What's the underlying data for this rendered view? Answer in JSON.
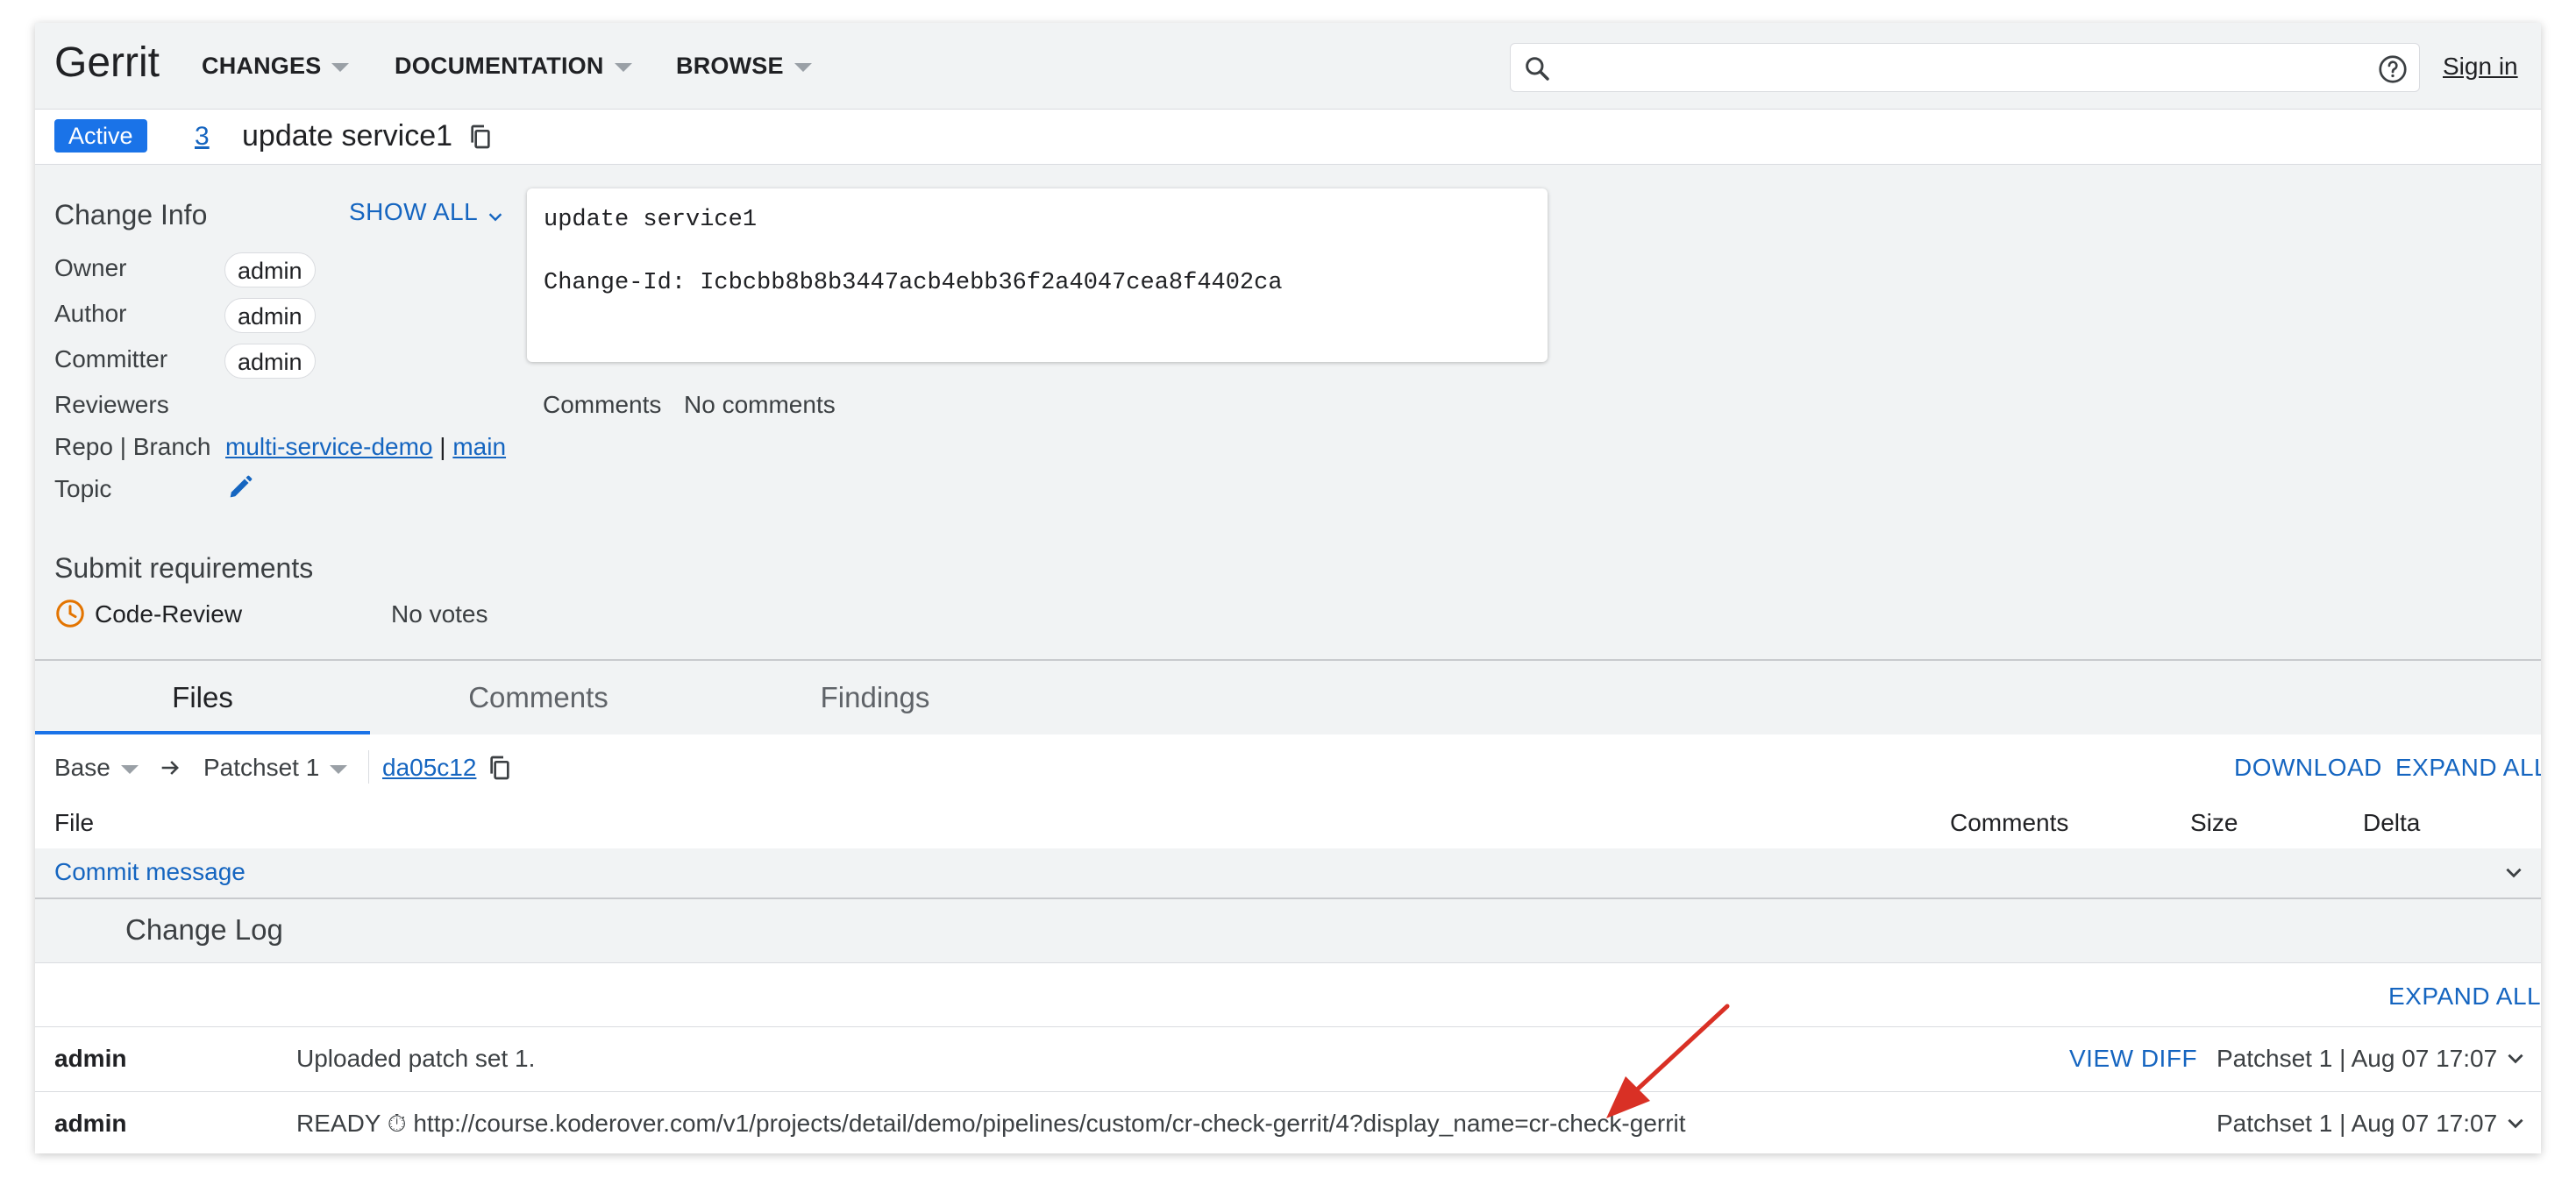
{
  "header": {
    "logo": "Gerrit",
    "nav": [
      "CHANGES",
      "DOCUMENTATION",
      "BROWSE"
    ],
    "search_value": "",
    "sign_in": "Sign in"
  },
  "change": {
    "status": "Active",
    "number": "3",
    "title": "update service1"
  },
  "info": {
    "heading": "Change Info",
    "show_all": "SHOW ALL",
    "owner_label": "Owner",
    "owner": "admin",
    "author_label": "Author",
    "author": "admin",
    "committer_label": "Committer",
    "committer": "admin",
    "reviewers_label": "Reviewers",
    "repo_label": "Repo | Branch",
    "repo": "multi-service-demo",
    "separator": "|",
    "branch": "main",
    "topic_label": "Topic"
  },
  "commit_message": {
    "line1": "update service1",
    "line2": "Change-Id: Icbcbb8b8b3447acb4ebb36f2a4047cea8f4402ca"
  },
  "comments_summary": {
    "label": "Comments",
    "value": "No comments"
  },
  "submit": {
    "heading": "Submit requirements",
    "requirement": "Code-Review",
    "votes": "No votes"
  },
  "tabs": [
    "Files",
    "Comments",
    "Findings"
  ],
  "files": {
    "base": "Base",
    "patchset": "Patchset 1",
    "commit": "da05c12",
    "download": "DOWNLOAD",
    "expand_all": "EXPAND ALL",
    "columns": [
      "File",
      "Comments",
      "Size",
      "Delta"
    ],
    "commit_message_row": "Commit message"
  },
  "changelog": {
    "heading": "Change Log",
    "expand_all": "EXPAND ALL",
    "entries": [
      {
        "author": "admin",
        "message": "Uploaded patch set 1.",
        "action": "VIEW DIFF",
        "meta": "Patchset 1 | Aug 07 17:07"
      },
      {
        "author": "admin",
        "message": "READY ⏱ http://course.koderover.com/v1/projects/detail/demo/pipelines/custom/cr-check-gerrit/4?display_name=cr-check-gerrit",
        "meta": "Patchset 1 | Aug 07 17:07"
      }
    ]
  },
  "colors": {
    "accent": "#1a73e8",
    "link": "#1565c0",
    "arrow": "#d93025",
    "clock": "#e37400"
  },
  "icons": [
    "search-icon",
    "help-icon",
    "copy-icon",
    "edit-icon",
    "clock-icon",
    "chevron-down-icon",
    "arrow-right-icon",
    "annotation-arrow"
  ]
}
